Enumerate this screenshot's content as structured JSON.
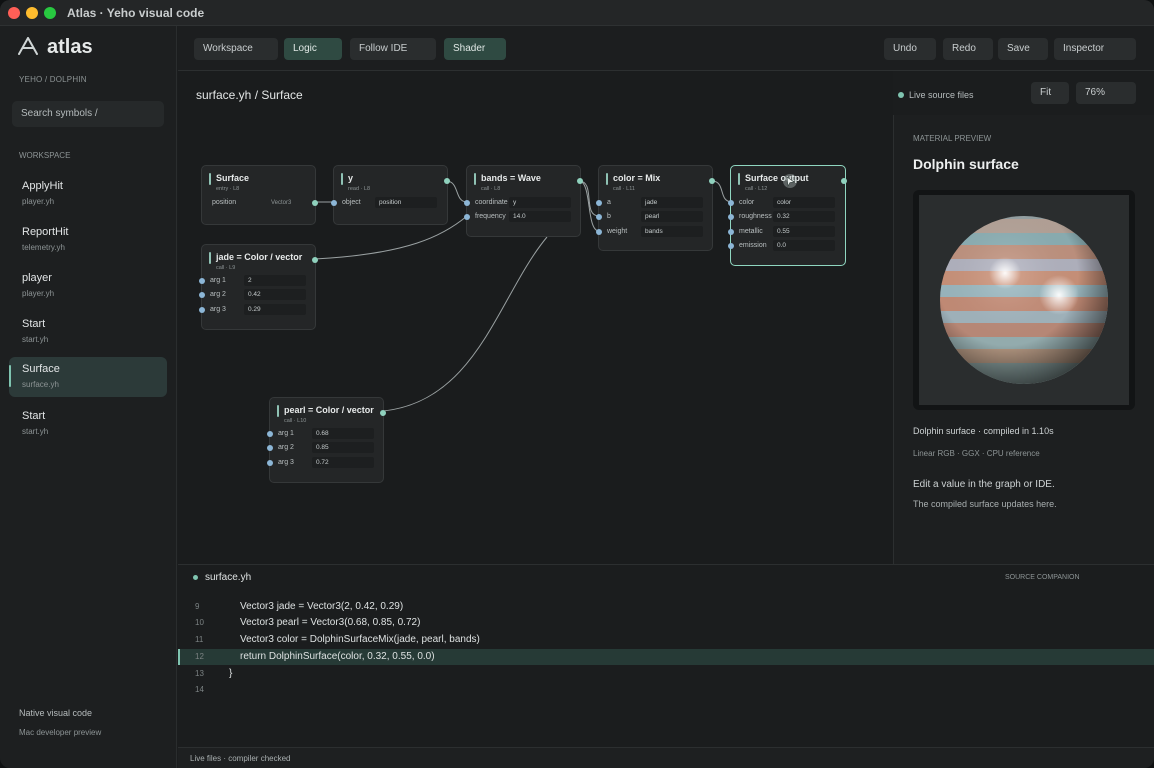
{
  "window": {
    "title": "Atlas · Yeho visual code"
  },
  "sidebar": {
    "brand": "atlas",
    "breadcrumb": "YEHO / DOLPHIN",
    "search_placeholder": "Search symbols  /",
    "section_label": "WORKSPACE",
    "items": [
      {
        "name": "ApplyHit",
        "file": "player.yh"
      },
      {
        "name": "ReportHit",
        "file": "telemetry.yh"
      },
      {
        "name": "player",
        "file": "player.yh"
      },
      {
        "name": "Start",
        "file": "start.yh"
      },
      {
        "name": "Surface",
        "file": "surface.yh"
      },
      {
        "name": "Start",
        "file": "start.yh"
      }
    ],
    "footer_title": "Native visual code",
    "footer_subtitle": "Mac developer preview"
  },
  "toolbar": {
    "tabs": [
      "Workspace",
      "Logic",
      "Follow IDE",
      "Shader"
    ],
    "actions": [
      "Undo",
      "Redo",
      "Save",
      "Inspector"
    ]
  },
  "canvas": {
    "breadcrumb": "surface.yh   /   Surface",
    "live_label": "Live source files",
    "fit_label": "Fit",
    "zoom_label": "76%",
    "nodes": {
      "surface": {
        "title": "Surface",
        "sub": "entry · L8",
        "port": "position",
        "type": "Vector3"
      },
      "y": {
        "title": "y",
        "sub": "read · L8",
        "port": "object",
        "value": "position"
      },
      "bands": {
        "title": "bands = Wave",
        "sub": "call · L8",
        "ports": [
          {
            "label": "coordinate",
            "value": "y"
          },
          {
            "label": "frequency",
            "value": "14.0"
          }
        ]
      },
      "mix": {
        "title": "color = Mix",
        "sub": "call · L11",
        "ports": [
          {
            "label": "a",
            "value": "jade"
          },
          {
            "label": "b",
            "value": "pearl"
          },
          {
            "label": "weight",
            "value": "bands"
          }
        ]
      },
      "output": {
        "title": "Surface output",
        "sub": "call · L12",
        "ports": [
          {
            "label": "color",
            "value": "color"
          },
          {
            "label": "roughness",
            "value": "0.32"
          },
          {
            "label": "metallic",
            "value": "0.55"
          },
          {
            "label": "emission",
            "value": "0.0"
          }
        ]
      },
      "jade": {
        "title": "jade = Color / vector",
        "sub": "call · L9",
        "ports": [
          {
            "label": "arg 1",
            "value": "2"
          },
          {
            "label": "arg 2",
            "value": "0.42"
          },
          {
            "label": "arg 3",
            "value": "0.29"
          }
        ]
      },
      "pearl": {
        "title": "pearl = Color / vector",
        "sub": "call · L10",
        "ports": [
          {
            "label": "arg 1",
            "value": "0.68"
          },
          {
            "label": "arg 2",
            "value": "0.85"
          },
          {
            "label": "arg 3",
            "value": "0.72"
          }
        ]
      }
    }
  },
  "inspector": {
    "label": "MATERIAL PREVIEW",
    "title": "Dolphin surface",
    "compiled": "Dolphin surface · compiled in 1.10s",
    "specs": "Linear RGB · GGX · CPU reference",
    "hint": "Edit a value in the graph or IDE.",
    "hint2": "The compiled surface updates here."
  },
  "code": {
    "file": "surface.yh",
    "companion": "SOURCE COMPANION",
    "lines": [
      {
        "n": "9",
        "text": "Vector3 jade = Vector3(2, 0.42, 0.29)"
      },
      {
        "n": "10",
        "text": "Vector3 pearl = Vector3(0.68, 0.85, 0.72)"
      },
      {
        "n": "11",
        "text": "Vector3 color = DolphinSurfaceMix(jade, pearl, bands)"
      },
      {
        "n": "12",
        "text": "return DolphinSurface(color, 0.32, 0.55, 0.0)"
      },
      {
        "n": "13",
        "text": "}"
      },
      {
        "n": "14",
        "text": ""
      }
    ]
  },
  "status": "Live files · compiler checked"
}
